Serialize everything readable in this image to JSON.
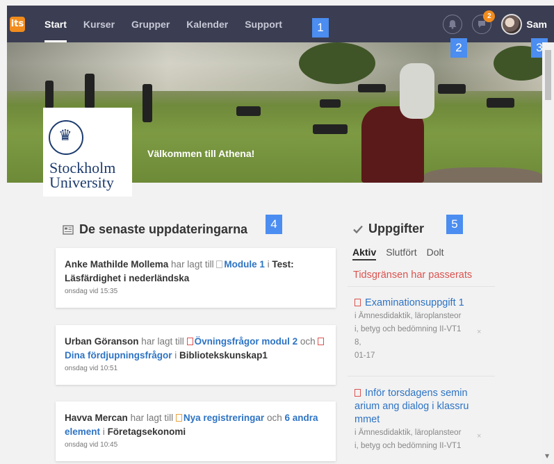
{
  "nav": {
    "logo": "its",
    "items": [
      "Start",
      "Kurser",
      "Grupper",
      "Kalender",
      "Support"
    ],
    "notification_badge": "2",
    "user_name": "Sam"
  },
  "markers": [
    "1",
    "2",
    "3",
    "4",
    "5"
  ],
  "hero": {
    "university_line1": "Stockholm",
    "university_line2": "University",
    "welcome": "Välkommen till Athena!"
  },
  "updates": {
    "title": "De senaste uppdateringarna",
    "cards": [
      {
        "author": "Anke Mathilde Mollema",
        "verb": "har lagt till",
        "item1": "Module 1",
        "prep": "i",
        "course": "Test: Läsfärdighet i nederländska",
        "when": "onsdag vid 15:35"
      },
      {
        "author": "Urban Göranson",
        "verb": "har lagt till",
        "item1": "Övningsfrågor modul 2",
        "conj": "och",
        "item2": "Dina fördjupningsfrågor",
        "prep": "i",
        "course": "Bibliotekskunskap1",
        "when": "onsdag vid 10:51"
      },
      {
        "author": "Havva Mercan",
        "verb": "har lagt till",
        "item1": "Nya registreringar",
        "conj": "och",
        "item2": "6 andra element",
        "prep": "i",
        "course": "Företagsekonomi",
        "when": "onsdag vid 10:45"
      }
    ]
  },
  "tasks": {
    "title": "Uppgifter",
    "tabs": [
      "Aktiv",
      "Slutfört",
      "Dolt"
    ],
    "overdue_label": "Tidsgränsen har passerats",
    "items": [
      {
        "name": "Examinationsuppgift 1",
        "meta_line1": "i Ämnesdidaktik, läroplansteor",
        "meta_line2": "i, betyg och bedömning II-VT1",
        "meta_line3": "8,",
        "meta_line4": "01-17",
        "dismiss": "×"
      },
      {
        "name_line1": "Inför torsdagens semin",
        "name_line2": "arium ang dialog i klassru",
        "name_line3": "mmet",
        "meta_line1": "i Ämnesdidaktik, läroplansteor",
        "meta_line2": "i, betyg och bedömning II-VT1",
        "dismiss": "×"
      }
    ]
  }
}
